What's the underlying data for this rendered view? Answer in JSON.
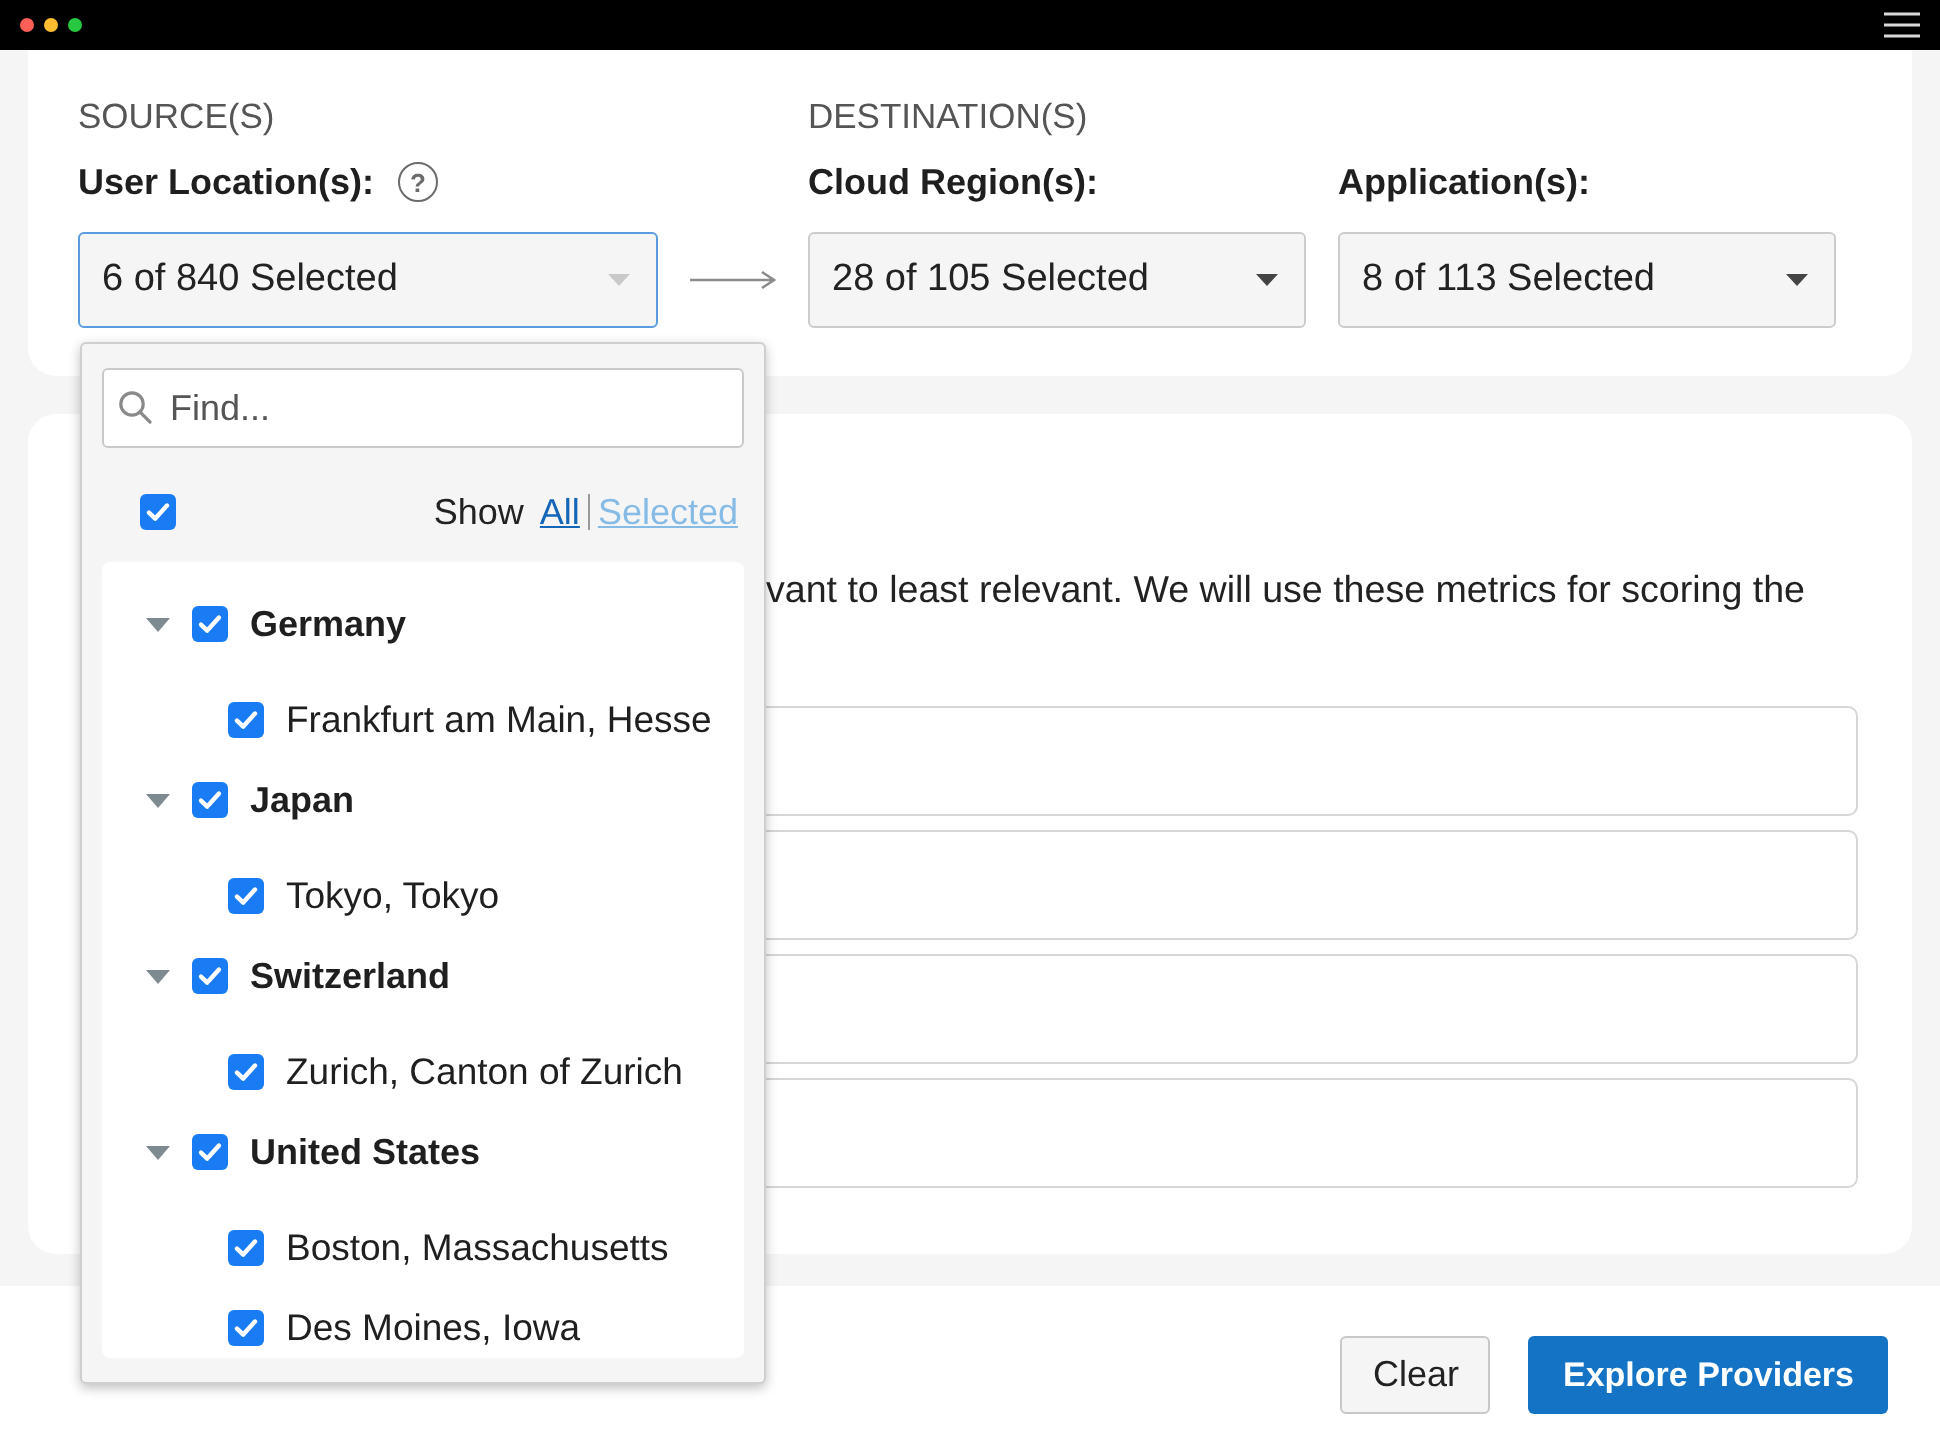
{
  "sources": {
    "heading": "SOURCE(S)",
    "selects": [
      {
        "label": "User Location(s):",
        "help": "?",
        "value": "6 of 840 Selected",
        "open": true
      }
    ]
  },
  "destinations": {
    "heading": "DESTINATION(S)",
    "selects": [
      {
        "label": "Cloud Region(s):",
        "value": "28 of 105 Selected",
        "open": false
      },
      {
        "label": "Application(s):",
        "value": "8 of 113 Selected",
        "open": false
      }
    ]
  },
  "location_picker": {
    "search": {
      "placeholder": "Find..."
    },
    "select_all": {
      "checked": true
    },
    "show_label": "Show",
    "filters": [
      {
        "label": "All",
        "selected": true
      },
      {
        "label": "Selected",
        "selected": false
      }
    ],
    "tree": [
      {
        "label": "Germany",
        "checked": true,
        "expanded": true,
        "children": [
          {
            "label": "Frankfurt am Main, Hesse",
            "checked": true
          }
        ]
      },
      {
        "label": "Japan",
        "checked": true,
        "expanded": true,
        "children": [
          {
            "label": "Tokyo, Tokyo",
            "checked": true
          }
        ]
      },
      {
        "label": "Switzerland",
        "checked": true,
        "expanded": true,
        "children": [
          {
            "label": "Zurich, Canton of Zurich",
            "checked": true
          }
        ]
      },
      {
        "label": "United States",
        "checked": true,
        "expanded": true,
        "children": [
          {
            "label": "Boston, Massachusetts",
            "checked": true
          },
          {
            "label": "Des Moines, Iowa",
            "checked": true
          }
        ]
      }
    ]
  },
  "metrics": {
    "description": "vant to least relevant. We will use these metrics for scoring the"
  },
  "actions": [
    {
      "label": "Clear",
      "kind": "secondary"
    },
    {
      "label": "Explore Providers",
      "kind": "primary"
    }
  ]
}
